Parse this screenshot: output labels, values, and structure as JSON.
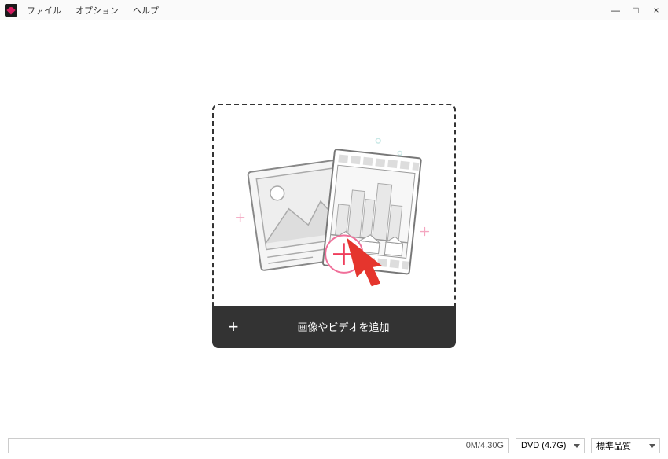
{
  "menu": {
    "file": "ファイル",
    "options": "オプション",
    "help": "ヘルプ"
  },
  "window": {
    "minimize": "—",
    "maximize": "□",
    "close": "×"
  },
  "dropzone": {
    "add_label": "画像やビデオを追加",
    "plus": "+"
  },
  "status": {
    "size": "0M/4.30G"
  },
  "selects": {
    "disc": "DVD (4.7G)",
    "quality": "標準品質"
  }
}
